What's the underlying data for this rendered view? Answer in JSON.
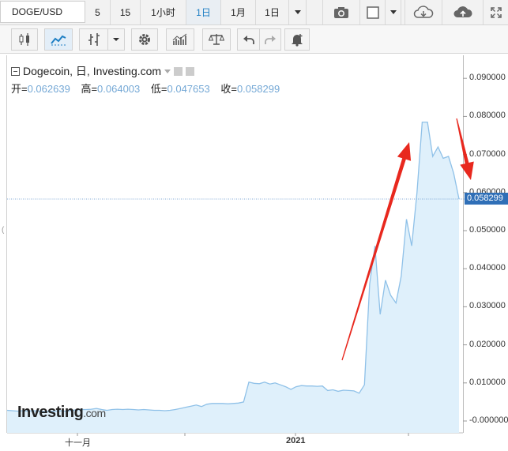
{
  "toolbar": {
    "symbol": "DOGE/USD",
    "intervals": [
      "5",
      "15",
      "1小时",
      "1日",
      "1月",
      "1日"
    ],
    "active_interval_index": 3
  },
  "legend": {
    "title": "Dogecoin, 日, Investing.com",
    "open_label": "开=",
    "open_value": "0.062639",
    "high_label": "高=",
    "high_value": "0.064003",
    "low_label": "低=",
    "low_value": "0.047653",
    "close_label": "收=",
    "close_value": "0.058299"
  },
  "brand": {
    "name": "Investing",
    "suffix": ".com"
  },
  "price_tag": "0.058299",
  "colors": {
    "accent": "#1e7fc4",
    "line": "#8fc1e8",
    "fill": "#dff0fb",
    "arrow": "#e8281e",
    "price_tag": "#2f6fb7"
  },
  "chart_data": {
    "type": "area",
    "x_labels": [
      "十一月",
      "2021"
    ],
    "y_ticks": [
      "0.090000",
      "0.080000",
      "0.070000",
      "0.060000",
      "0.050000",
      "0.040000",
      "0.030000",
      "0.020000",
      "0.010000",
      "-0.000000"
    ],
    "ylim": [
      -0.002,
      0.095
    ],
    "last_value": 0.058299,
    "values": [
      0.0028,
      0.0027,
      0.0026,
      0.0027,
      0.0026,
      0.0027,
      0.0026,
      0.0025,
      0.0026,
      0.0026,
      0.0027,
      0.0026,
      0.0027,
      0.0029,
      0.003,
      0.003,
      0.0031,
      0.0033,
      0.003,
      0.0028,
      0.003,
      0.0031,
      0.003,
      0.0031,
      0.003,
      0.0029,
      0.003,
      0.0029,
      0.0028,
      0.0028,
      0.0027,
      0.0028,
      0.003,
      0.0033,
      0.0036,
      0.0039,
      0.0042,
      0.0038,
      0.0044,
      0.0046,
      0.0046,
      0.0046,
      0.0045,
      0.0046,
      0.0047,
      0.005,
      0.0102,
      0.0099,
      0.0098,
      0.0102,
      0.0097,
      0.01,
      0.0095,
      0.009,
      0.0083,
      0.009,
      0.0093,
      0.0092,
      0.0092,
      0.0091,
      0.0092,
      0.008,
      0.0082,
      0.0078,
      0.0081,
      0.008,
      0.0079,
      0.0073,
      0.0095,
      0.036,
      0.046,
      0.028,
      0.037,
      0.033,
      0.031,
      0.038,
      0.053,
      0.046,
      0.06,
      0.0785,
      0.0785,
      0.0695,
      0.072,
      0.069,
      0.0695,
      0.065,
      0.0583
    ],
    "grid": false
  }
}
